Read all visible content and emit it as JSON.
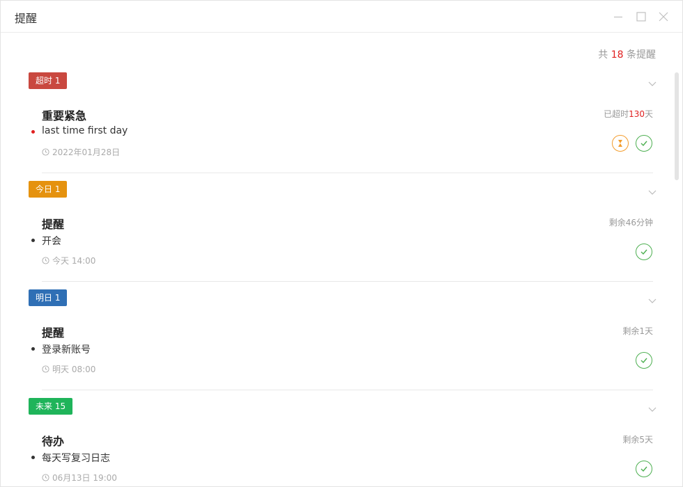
{
  "window": {
    "title": "提醒"
  },
  "summary": {
    "prefix": "共",
    "count": "18",
    "suffix": "条提醒"
  },
  "colors": {
    "overdue": "#c9483f",
    "today": "#e5920f",
    "tomorrow": "#2f6fb5",
    "future": "#1fb45a",
    "done": "#4caf50",
    "snooze": "#f39c2c",
    "highlight": "#e02020"
  },
  "groups": [
    {
      "tag": "超时 1",
      "item": {
        "title": "重要紧急",
        "remain_prefix": "已超时",
        "remain_value": "130",
        "remain_suffix": "天",
        "desc": "last time first day",
        "time": "2022年01月28日"
      }
    },
    {
      "tag": "今日 1",
      "item": {
        "title": "提醒",
        "remain": "剩余46分钟",
        "desc": "开会",
        "time": "今天 14:00"
      }
    },
    {
      "tag": "明日 1",
      "item": {
        "title": "提醒",
        "remain": "剩余1天",
        "desc": "登录新账号",
        "time": "明天 08:00"
      }
    },
    {
      "tag": "未来 15",
      "item": {
        "title": "待办",
        "remain": "剩余5天",
        "desc": "每天写复习日志",
        "time": "06月13日 19:00"
      }
    }
  ]
}
